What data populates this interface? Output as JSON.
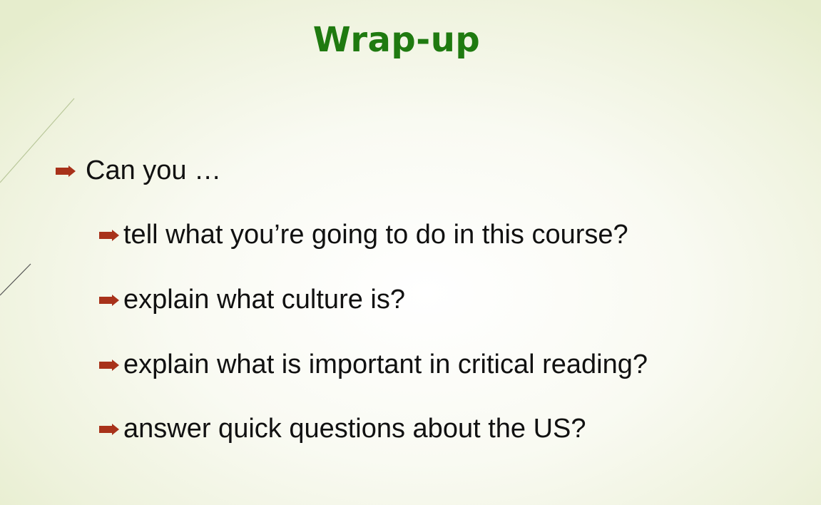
{
  "slide": {
    "title": "Wrap-up",
    "intro_bullet": "Can you …",
    "questions": [
      "tell what you’re going to do in this course?",
      "explain what culture is?",
      "explain what is important in critical reading?",
      "answer quick questions about the US?"
    ]
  },
  "colors": {
    "title": "#1f7a10",
    "bullet_arrow": "#a8321a",
    "text": "#111111",
    "background_edge": "#e6edcd",
    "background_center": "#ffffff"
  },
  "icons": {
    "bullet": "right-arrow-icon"
  }
}
